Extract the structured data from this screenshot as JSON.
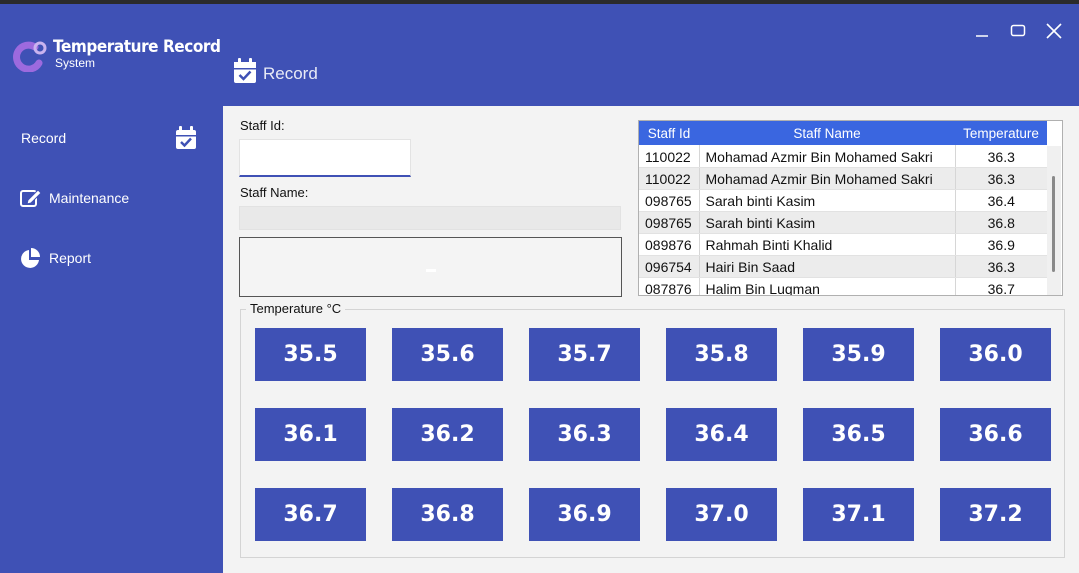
{
  "app": {
    "logo_title": "Temperature Record",
    "logo_subtitle": "System",
    "accent": "#3f51b5"
  },
  "window_controls": [
    "minimize-icon",
    "maximize-icon",
    "close-icon"
  ],
  "header": {
    "title": "Record",
    "icon": "calendar-check-icon"
  },
  "sidebar": {
    "items": [
      {
        "label": "Record",
        "icon": "calendar-check-icon"
      },
      {
        "label": "Maintenance",
        "icon": "edit-icon"
      },
      {
        "label": "Report",
        "icon": "pie-chart-icon"
      }
    ]
  },
  "form": {
    "staff_id_label": "Staff Id:",
    "staff_id_value": "",
    "staff_name_label": "Staff Name:",
    "staff_name_value": ""
  },
  "table": {
    "columns": [
      "Staff Id",
      "Staff Name",
      "Temperature"
    ],
    "rows": [
      [
        "110022",
        "Mohamad Azmir Bin Mohamed Sakri",
        "36.3"
      ],
      [
        "110022",
        "Mohamad Azmir Bin Mohamed Sakri",
        "36.3"
      ],
      [
        "098765",
        "Sarah binti Kasim",
        "36.4"
      ],
      [
        "098765",
        "Sarah binti Kasim",
        "36.8"
      ],
      [
        "089876",
        "Rahmah Binti Khalid",
        "36.9"
      ],
      [
        "096754",
        "Hairi Bin Saad",
        "36.3"
      ],
      [
        "087876",
        "Halim Bin Luqman",
        "36.7"
      ]
    ]
  },
  "temperature": {
    "group_label": "Temperature °C",
    "buttons": [
      "35.5",
      "35.6",
      "35.7",
      "35.8",
      "35.9",
      "36.0",
      "36.1",
      "36.2",
      "36.3",
      "36.4",
      "36.5",
      "36.6",
      "36.7",
      "36.8",
      "36.9",
      "37.0",
      "37.1",
      "37.2"
    ]
  }
}
